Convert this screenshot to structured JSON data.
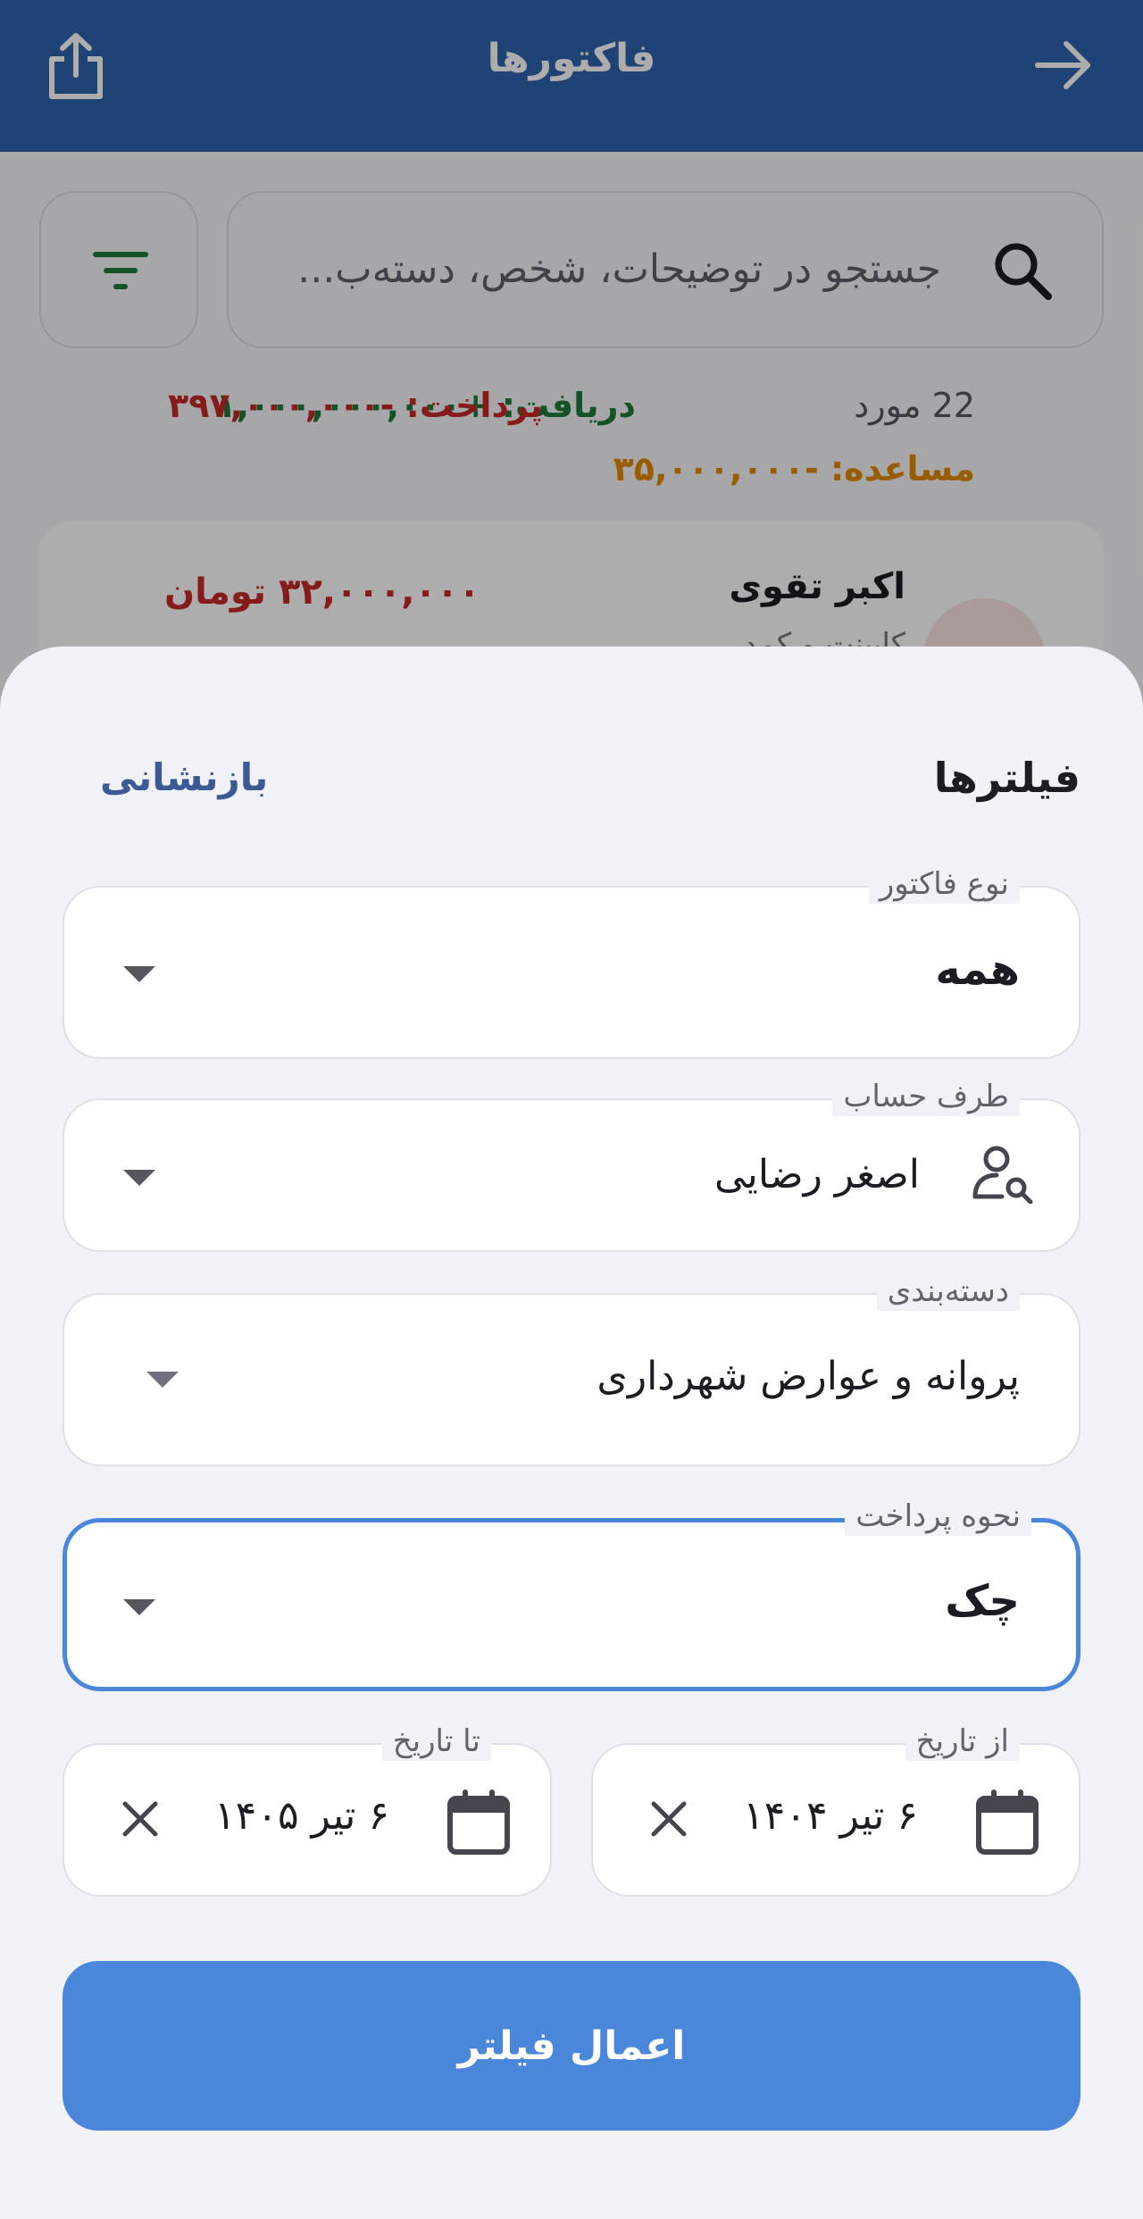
{
  "appbar": {
    "title": "فاکتورها",
    "share_icon": "share-icon",
    "back_icon": "arrow-right-icon"
  },
  "search": {
    "placeholder": "جستجو در توضیحات، شخص، دسته‌ب..."
  },
  "stats": {
    "count": "22 مورد",
    "receive": "دریافت: +۱,۰۰۰,۰۰۰,۰۰۰",
    "pay": "پرداخت: -۳۹۷,۰۰۰,۰۰۰",
    "advance": "مساعده: -۳۵,۰۰۰,۰۰۰"
  },
  "list": {
    "items": [
      {
        "name": "اکبر تقوی",
        "subtitle": "کابینت و کمد",
        "amount": "۳۲,۰۰۰,۰۰۰ تومان"
      }
    ]
  },
  "sheet": {
    "title": "فیلترها",
    "reset_label": "بازنشانی",
    "invoice_type": {
      "label": "نوع فاکتور",
      "value": "همه"
    },
    "account": {
      "label": "طرف حساب",
      "value": "اصغر رضایی"
    },
    "category": {
      "label": "دسته‌بندی",
      "value": "پروانه و عوارض شهرداری"
    },
    "payment_method": {
      "label": "نحوه پرداخت",
      "value": "چک"
    },
    "date_from": {
      "label": "از تاریخ",
      "value": "۶ تیر ۱۴۰۴"
    },
    "date_to": {
      "label": "تا تاریخ",
      "value": "۶ تیر ۱۴۰۵"
    },
    "apply_label": "اعمال فیلتر"
  },
  "colors": {
    "primary": "#2f64ad",
    "accent": "#4a86d9",
    "receive": "#1e7a3a",
    "pay": "#c62828",
    "advance": "#e08a00"
  }
}
